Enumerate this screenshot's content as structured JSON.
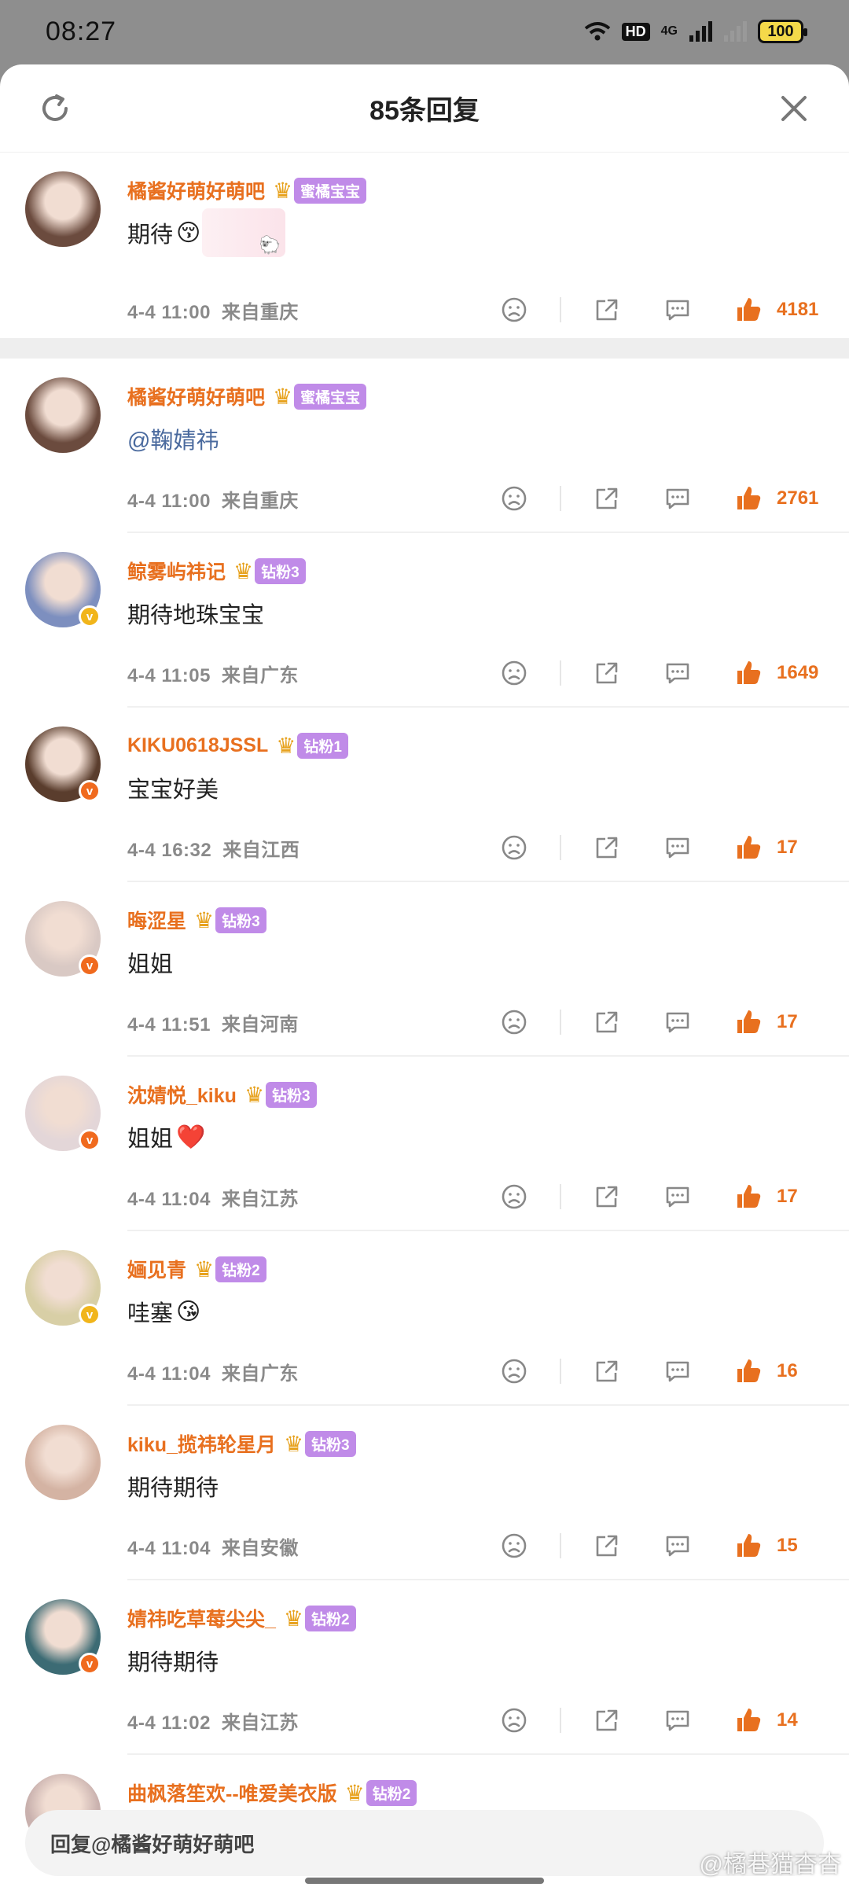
{
  "status_bar": {
    "time": "08:27",
    "network": "4G",
    "hd": "HD",
    "battery": "100"
  },
  "header": {
    "title": "85条回复"
  },
  "comments": [
    {
      "username": "橘酱好萌好萌吧",
      "badge": "蜜橘宝宝",
      "text": "期待",
      "emoji": "😚",
      "date": "4-4",
      "time": "11:00",
      "location": "来自重庆",
      "likes": "4181",
      "avatar_color": "#6b4b3e"
    },
    {
      "username": "橘酱好萌好萌吧",
      "badge": "蜜橘宝宝",
      "text": "@鞠婧祎",
      "date": "4-4",
      "time": "11:00",
      "location": "来自重庆",
      "likes": "2761",
      "avatar_color": "#6b4b3e"
    },
    {
      "username": "鲸雾屿祎记",
      "badge": "钻粉3",
      "text": "期待地珠宝宝",
      "date": "4-4",
      "time": "11:05",
      "location": "来自广东",
      "likes": "1649",
      "avatar_color": "#7d8fbf",
      "verify_color": "#f1b51b"
    },
    {
      "username": "KIKU0618JSSL",
      "badge": "钻粉1",
      "text": "宝宝好美",
      "date": "4-4",
      "time": "16:32",
      "location": "来自江西",
      "likes": "17",
      "avatar_color": "#5a3d2d",
      "verify_color": "#f06a1e"
    },
    {
      "username": "晦涩星",
      "badge": "钻粉3",
      "text": "姐姐",
      "date": "4-4",
      "time": "11:51",
      "location": "来自河南",
      "likes": "17",
      "avatar_color": "#d9c9c4",
      "verify_color": "#f06a1e"
    },
    {
      "username": "沈婧悦_kiku",
      "badge": "钻粉3",
      "text": "姐姐",
      "emoji": "❤️",
      "date": "4-4",
      "time": "11:04",
      "location": "来自江苏",
      "likes": "17",
      "avatar_color": "#e3d6d8",
      "verify_color": "#f06a1e"
    },
    {
      "username": "婳见青",
      "badge": "钻粉2",
      "text": "哇塞",
      "emoji": "😘",
      "date": "4-4",
      "time": "11:04",
      "location": "来自广东",
      "likes": "16",
      "avatar_color": "#d8cfa6",
      "verify_color": "#f1b51b"
    },
    {
      "username": "kiku_揽祎轮星月",
      "badge": "钻粉3",
      "text": "期待期待",
      "date": "4-4",
      "time": "11:04",
      "location": "来自安徽",
      "likes": "15",
      "avatar_color": "#d4b3a3"
    },
    {
      "username": "婧祎吃草莓尖尖_",
      "badge": "钻粉2",
      "text": "期待期待",
      "date": "4-4",
      "time": "11:02",
      "location": "来自江苏",
      "likes": "14",
      "avatar_color": "#3c6b74",
      "verify_color": "#f06a1e"
    },
    {
      "username": "曲枫落笙欢--唯爱美衣版",
      "badge": "钻粉2",
      "avatar_color": "#c9b1ae"
    }
  ],
  "reply_placeholder": "回复@橘酱好萌好萌吧",
  "watermark": "@橘巷猫杳杳",
  "colors": {
    "accent": "#e8701f",
    "fan_badge": "#c08be8",
    "mention": "#4a6a9e"
  },
  "icons": [
    "refresh-icon",
    "close-icon",
    "dislike-icon",
    "share-icon",
    "comment-icon",
    "like-icon",
    "crown-icon"
  ]
}
